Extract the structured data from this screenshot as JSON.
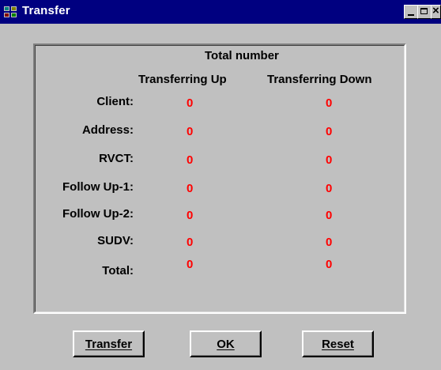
{
  "window": {
    "title": "Transfer",
    "icon": "app-icon"
  },
  "header": {
    "group_title": "Total number",
    "col_up": "Transferring Up",
    "col_down": "Transferring Down"
  },
  "rows": [
    {
      "label": "Client:",
      "up": "0",
      "down": "0"
    },
    {
      "label": "Address:",
      "up": "0",
      "down": "0"
    },
    {
      "label": "RVCT:",
      "up": "0",
      "down": "0"
    },
    {
      "label": "Follow Up-1:",
      "up": "0",
      "down": "0"
    },
    {
      "label": "Follow Up-2:",
      "up": "0",
      "down": "0"
    },
    {
      "label": "SUDV:",
      "up": "0",
      "down": "0"
    },
    {
      "label": "Total:",
      "up": "0",
      "down": "0"
    }
  ],
  "buttons": {
    "transfer": "Transfer",
    "ok": "OK",
    "reset": "Reset"
  },
  "colors": {
    "title_bar": "#000080",
    "value": "#ff0000",
    "face": "#c0c0c0"
  }
}
